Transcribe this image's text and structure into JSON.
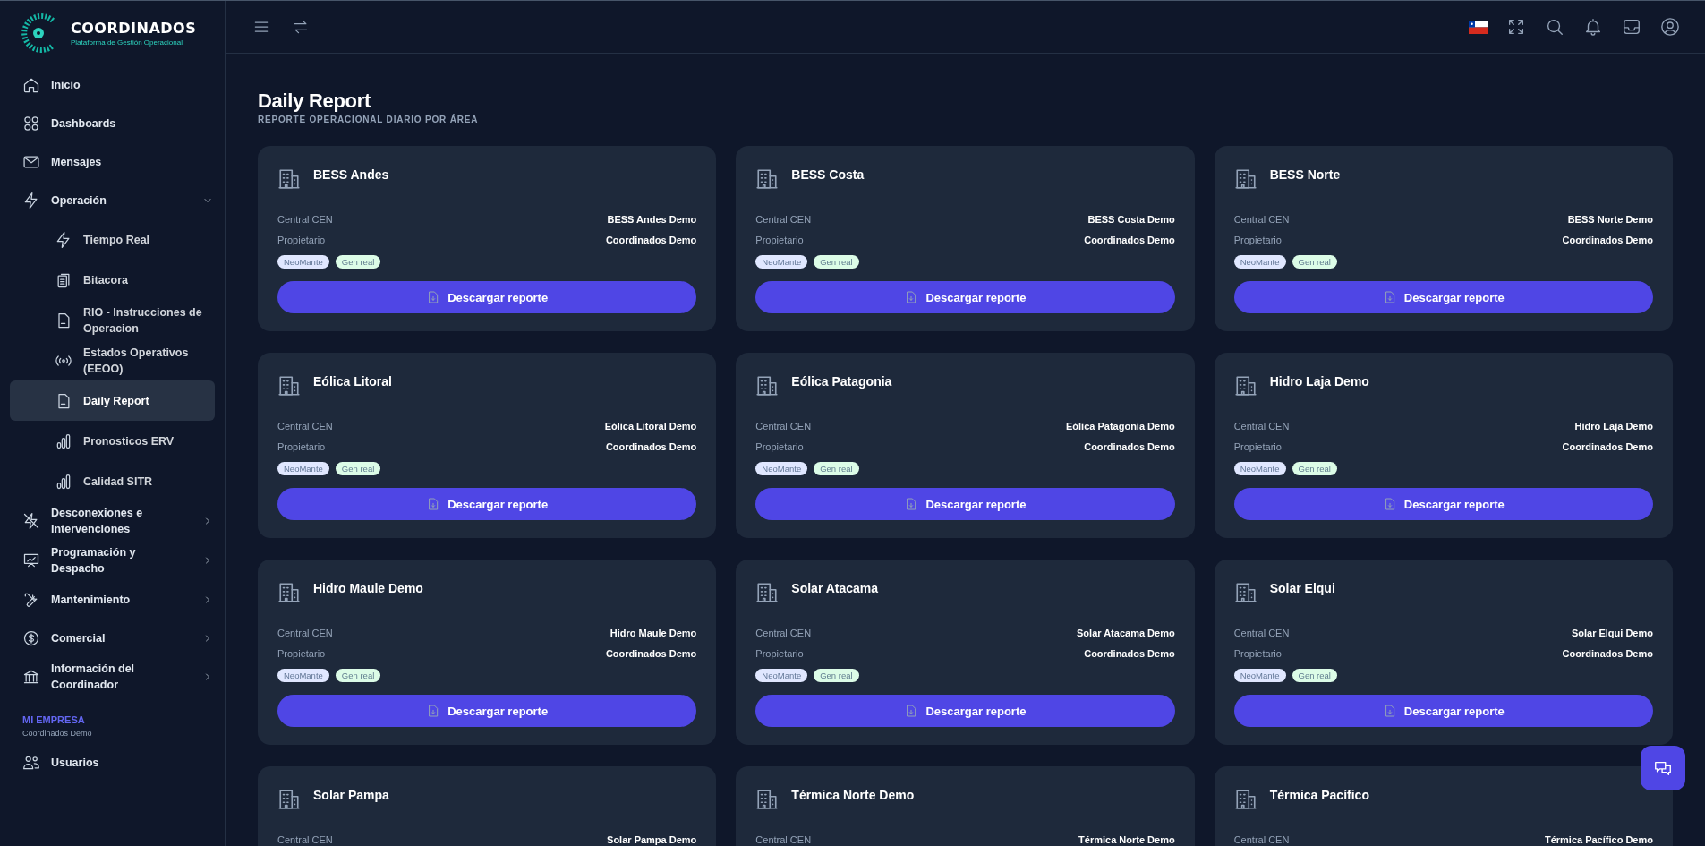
{
  "brand": {
    "name": "COORDINADOS",
    "tagline": "Plataforma de Gestión Operacional"
  },
  "sidebar": {
    "items": [
      {
        "label": "Inicio",
        "kind": "link",
        "selected": false
      },
      {
        "label": "Dashboards",
        "kind": "link",
        "selected": false
      },
      {
        "label": "Mensajes",
        "kind": "link",
        "selected": false
      },
      {
        "label": "Operación",
        "kind": "group",
        "expanded": true,
        "selected": false,
        "children": [
          {
            "label": "Tiempo Real",
            "selected": false
          },
          {
            "label": "Bitacora",
            "selected": false
          },
          {
            "label": "RIO - Instrucciones de Operacion",
            "selected": false
          },
          {
            "label": "Estados Operativos (EEOO)",
            "selected": false
          },
          {
            "label": "Daily Report",
            "selected": true
          },
          {
            "label": "Pronosticos ERV",
            "selected": false
          },
          {
            "label": "Calidad SITR",
            "selected": false
          }
        ]
      },
      {
        "label": "Desconexiones e Intervenciones",
        "kind": "group",
        "expanded": false,
        "selected": false
      },
      {
        "label": "Programación y Despacho",
        "kind": "group",
        "expanded": false,
        "selected": false
      },
      {
        "label": "Mantenimiento",
        "kind": "group",
        "expanded": false,
        "selected": false
      },
      {
        "label": "Comercial",
        "kind": "group",
        "expanded": false,
        "selected": false
      },
      {
        "label": "Información del Coordinador",
        "kind": "group",
        "expanded": false,
        "selected": false
      }
    ],
    "section": {
      "title": "MI EMPRESA",
      "subtitle": "Coordinados Demo",
      "items": [
        {
          "label": "Usuarios",
          "selected": false
        }
      ]
    }
  },
  "page": {
    "title": "Daily Report",
    "subtitle": "REPORTE OPERACIONAL DIARIO POR ÁREA"
  },
  "cards": [
    {
      "name": "BESS Andes",
      "fields": [
        {
          "label": "Central CEN",
          "value": "BESS Andes Demo"
        },
        {
          "label": "Propietario",
          "value": "Coordinados Demo"
        }
      ],
      "tags": [
        {
          "label": "NeoMante",
          "color": "#e0e7ff"
        },
        {
          "label": "Gen real",
          "color": "#dcfce7"
        }
      ],
      "button": "Descargar reporte"
    },
    {
      "name": "BESS Costa",
      "fields": [
        {
          "label": "Central CEN",
          "value": "BESS Costa Demo"
        },
        {
          "label": "Propietario",
          "value": "Coordinados Demo"
        }
      ],
      "tags": [
        {
          "label": "NeoMante",
          "color": "#e0e7ff"
        },
        {
          "label": "Gen real",
          "color": "#dcfce7"
        }
      ],
      "button": "Descargar reporte"
    },
    {
      "name": "BESS Norte",
      "fields": [
        {
          "label": "Central CEN",
          "value": "BESS Norte Demo"
        },
        {
          "label": "Propietario",
          "value": "Coordinados Demo"
        }
      ],
      "tags": [
        {
          "label": "NeoMante",
          "color": "#e0e7ff"
        },
        {
          "label": "Gen real",
          "color": "#dcfce7"
        }
      ],
      "button": "Descargar reporte"
    },
    {
      "name": "Eólica Litoral",
      "fields": [
        {
          "label": "Central CEN",
          "value": "Eólica Litoral Demo"
        },
        {
          "label": "Propietario",
          "value": "Coordinados Demo"
        }
      ],
      "tags": [
        {
          "label": "NeoMante",
          "color": "#e0e7ff"
        },
        {
          "label": "Gen real",
          "color": "#dcfce7"
        }
      ],
      "button": "Descargar reporte"
    },
    {
      "name": "Eólica Patagonia",
      "fields": [
        {
          "label": "Central CEN",
          "value": "Eólica Patagonia Demo"
        },
        {
          "label": "Propietario",
          "value": "Coordinados Demo"
        }
      ],
      "tags": [
        {
          "label": "NeoMante",
          "color": "#e0e7ff"
        },
        {
          "label": "Gen real",
          "color": "#dcfce7"
        }
      ],
      "button": "Descargar reporte"
    },
    {
      "name": "Hidro Laja Demo",
      "fields": [
        {
          "label": "Central CEN",
          "value": "Hidro Laja Demo"
        },
        {
          "label": "Propietario",
          "value": "Coordinados Demo"
        }
      ],
      "tags": [
        {
          "label": "NeoMante",
          "color": "#e0e7ff"
        },
        {
          "label": "Gen real",
          "color": "#dcfce7"
        }
      ],
      "button": "Descargar reporte"
    },
    {
      "name": "Hidro Maule Demo",
      "fields": [
        {
          "label": "Central CEN",
          "value": "Hidro Maule Demo"
        },
        {
          "label": "Propietario",
          "value": "Coordinados Demo"
        }
      ],
      "tags": [
        {
          "label": "NeoMante",
          "color": "#e0e7ff"
        },
        {
          "label": "Gen real",
          "color": "#dcfce7"
        }
      ],
      "button": "Descargar reporte"
    },
    {
      "name": "Solar Atacama",
      "fields": [
        {
          "label": "Central CEN",
          "value": "Solar Atacama Demo"
        },
        {
          "label": "Propietario",
          "value": "Coordinados Demo"
        }
      ],
      "tags": [
        {
          "label": "NeoMante",
          "color": "#e0e7ff"
        },
        {
          "label": "Gen real",
          "color": "#dcfce7"
        }
      ],
      "button": "Descargar reporte"
    },
    {
      "name": "Solar Elqui",
      "fields": [
        {
          "label": "Central CEN",
          "value": "Solar Elqui Demo"
        },
        {
          "label": "Propietario",
          "value": "Coordinados Demo"
        }
      ],
      "tags": [
        {
          "label": "NeoMante",
          "color": "#e0e7ff"
        },
        {
          "label": "Gen real",
          "color": "#dcfce7"
        }
      ],
      "button": "Descargar reporte"
    },
    {
      "name": "Solar Pampa",
      "fields": [
        {
          "label": "Central CEN",
          "value": "Solar Pampa Demo"
        }
      ]
    },
    {
      "name": "Térmica Norte Demo",
      "fields": [
        {
          "label": "Central CEN",
          "value": "Térmica Norte Demo"
        }
      ]
    },
    {
      "name": "Térmica Pacífico",
      "fields": [
        {
          "label": "Central CEN",
          "value": "Térmica Pacífico Demo"
        }
      ]
    }
  ]
}
